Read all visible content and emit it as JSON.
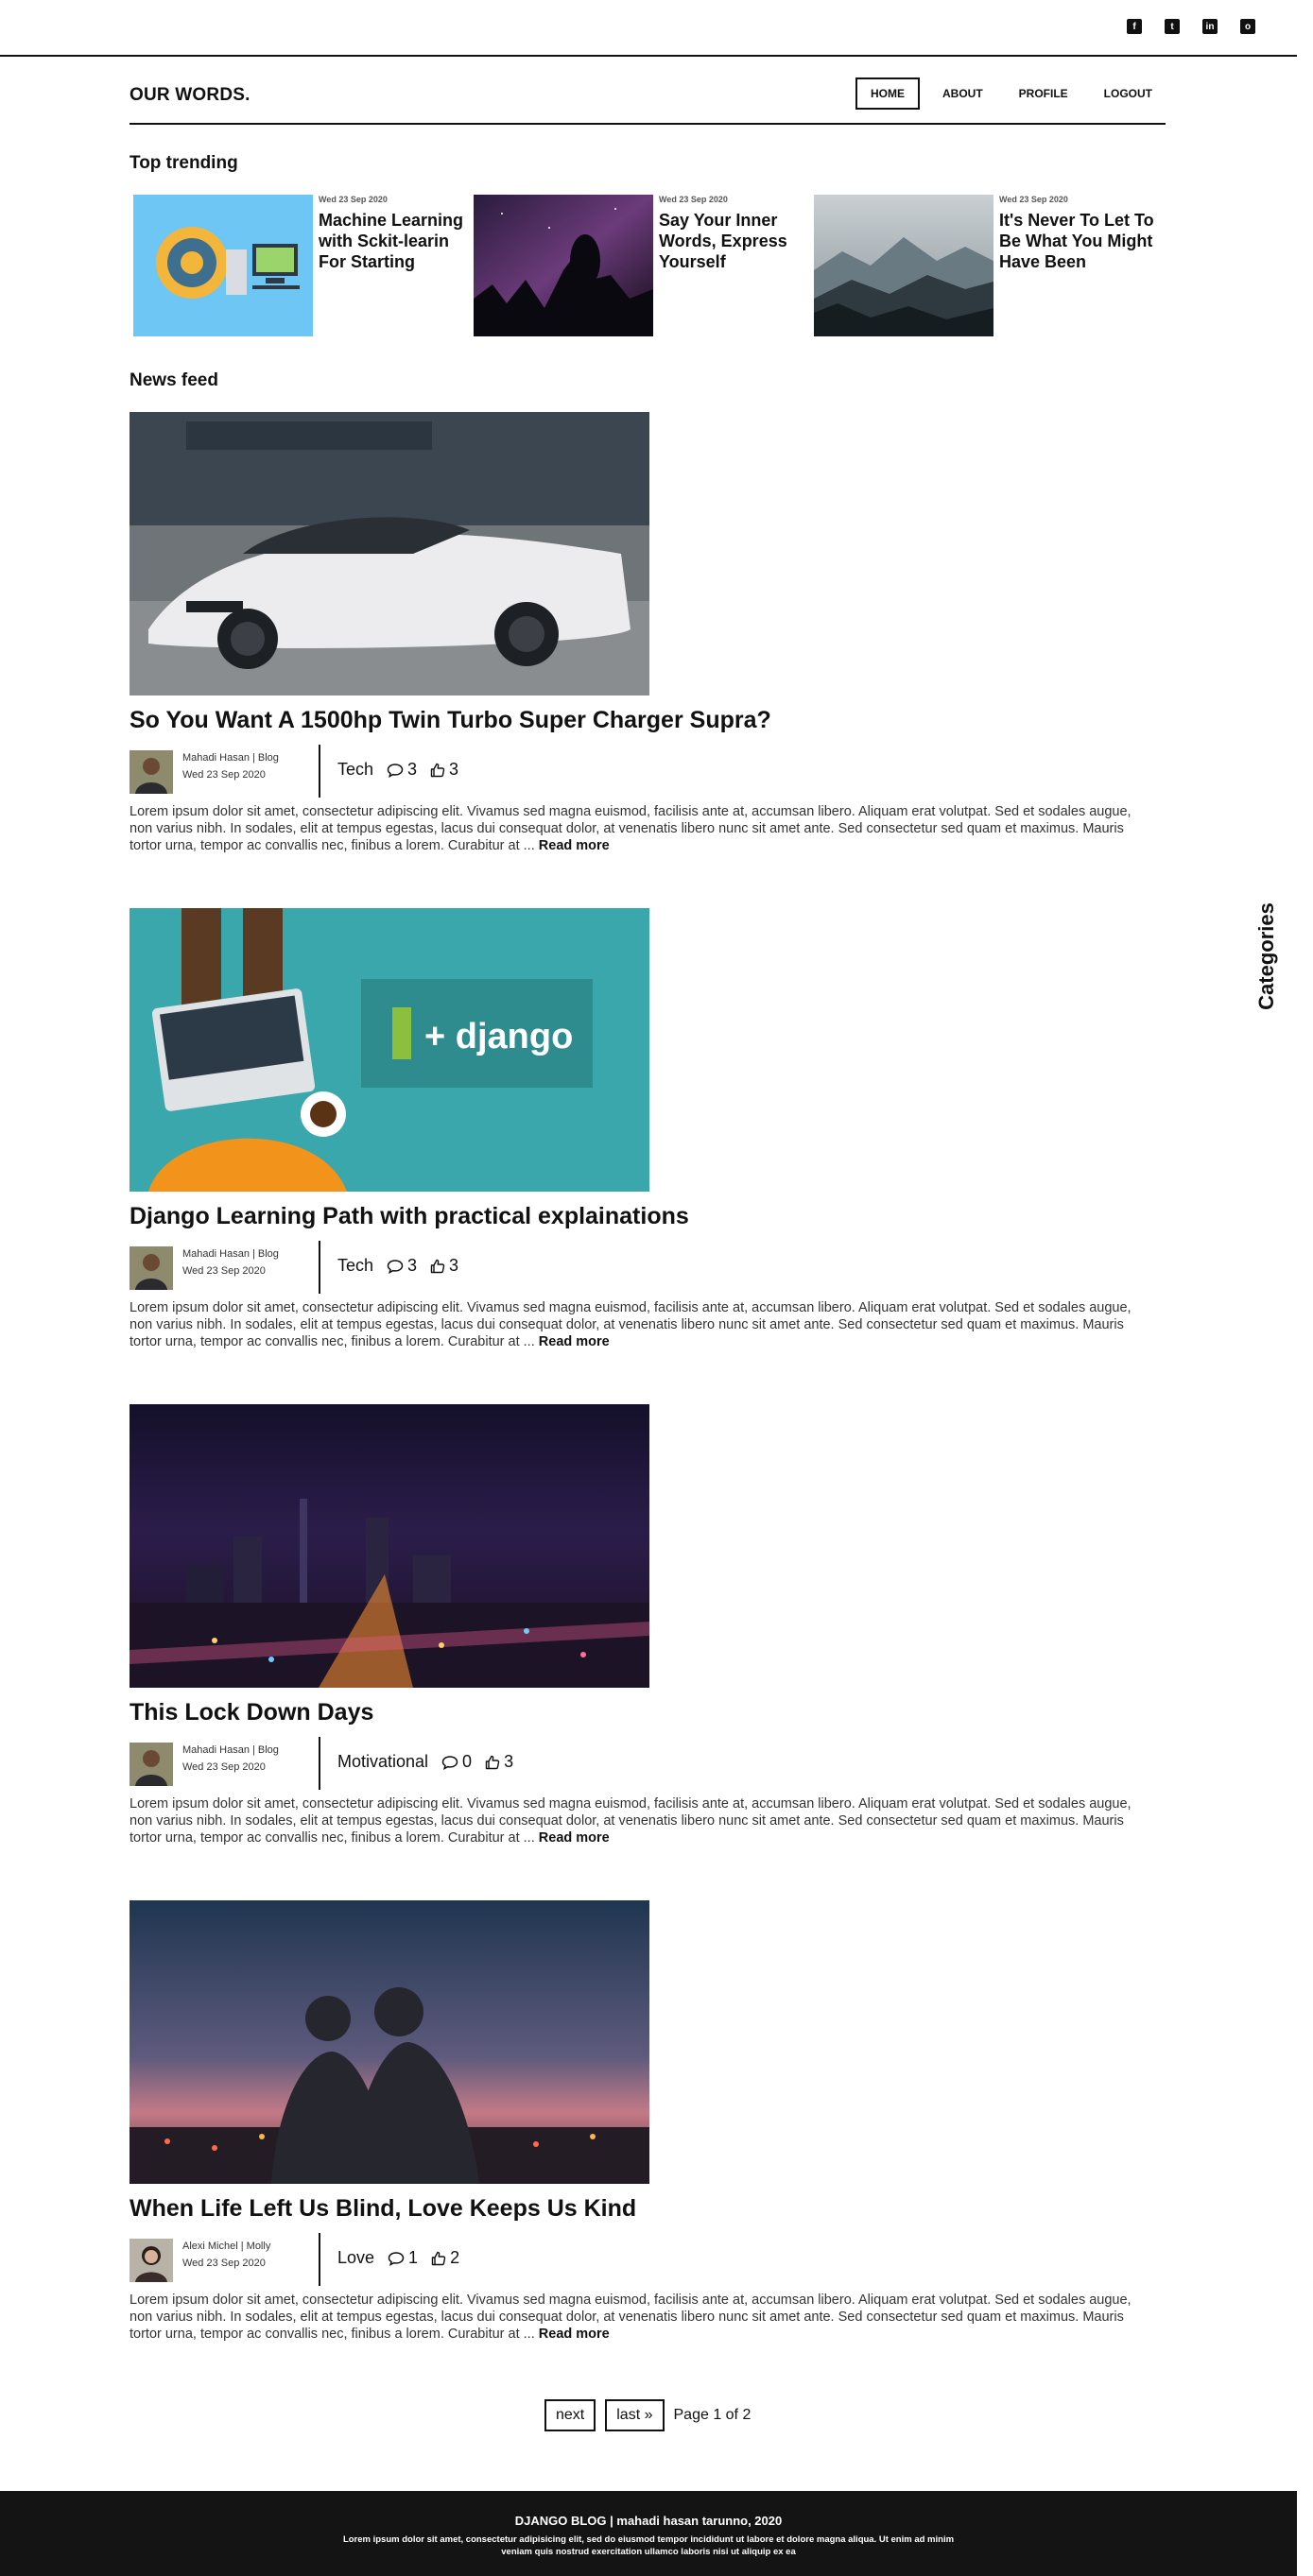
{
  "social": [
    {
      "name": "facebook",
      "icon": "facebook-icon",
      "glyph": "f"
    },
    {
      "name": "twitter",
      "icon": "twitter-icon",
      "glyph": "t"
    },
    {
      "name": "linkedin",
      "icon": "linkedin-icon",
      "glyph": "in"
    },
    {
      "name": "github",
      "icon": "github-icon",
      "glyph": "o"
    }
  ],
  "header": {
    "brand": "OUR WORDS.",
    "nav": [
      {
        "label": "HOME",
        "active": true
      },
      {
        "label": "ABOUT",
        "active": false
      },
      {
        "label": "PROFILE",
        "active": false
      },
      {
        "label": "LOGOUT",
        "active": false
      }
    ]
  },
  "trending": {
    "title": "Top trending",
    "items": [
      {
        "date": "Wed 23 Sep 2020",
        "title": "Machine Learning with Sckit-learin For Starting",
        "image": "ml-illustration"
      },
      {
        "date": "Wed 23 Sep 2020",
        "title": "Say Your Inner Words, Express Yourself",
        "image": "night-sky-photo"
      },
      {
        "date": "Wed 23 Sep 2020",
        "title": "It's Never To Let To Be What You Might Have Been",
        "image": "mountain-photo"
      }
    ]
  },
  "feed": {
    "title": "News feed",
    "posts": [
      {
        "title": "So You Want A 1500hp Twin Turbo Super Charger Supra?",
        "author": "Mahadi Hasan | Blog",
        "date": "Wed 23 Sep 2020",
        "category": "Tech",
        "comments": "3",
        "likes": "3",
        "image": "car-photo",
        "excerpt": "Lorem ipsum dolor sit amet, consectetur adipiscing elit. Vivamus sed magna euismod, facilisis ante at, accumsan libero. Aliquam erat volutpat. Sed et sodales augue, non varius nibh. In sodales, elit at tempus egestas, lacus dui consequat dolor, at venenatis libero nunc sit amet ante. Sed consectetur sed quam et maximus. Mauris tortor urna, tempor ac convallis nec, finibus a lorem. Curabitur at ...",
        "read_more": "Read more"
      },
      {
        "title": "Django Learning Path with practical explainations",
        "author": "Mahadi Hasan | Blog",
        "date": "Wed 23 Sep 2020",
        "category": "Tech",
        "comments": "3",
        "likes": "3",
        "image": "django-illustration",
        "image_text": "+ django",
        "excerpt": "Lorem ipsum dolor sit amet, consectetur adipiscing elit. Vivamus sed magna euismod, facilisis ante at, accumsan libero. Aliquam erat volutpat. Sed et sodales augue, non varius nibh. In sodales, elit at tempus egestas, lacus dui consequat dolor, at venenatis libero nunc sit amet ante. Sed consectetur sed quam et maximus. Mauris tortor urna, tempor ac convallis nec, finibus a lorem. Curabitur at ...",
        "read_more": "Read more"
      },
      {
        "title": "This Lock Down Days",
        "author": "Mahadi Hasan | Blog",
        "date": "Wed 23 Sep 2020",
        "category": "Motivational",
        "comments": "0",
        "likes": "3",
        "image": "city-night-photo",
        "excerpt": "Lorem ipsum dolor sit amet, consectetur adipiscing elit. Vivamus sed magna euismod, facilisis ante at, accumsan libero. Aliquam erat volutpat. Sed et sodales augue, non varius nibh. In sodales, elit at tempus egestas, lacus dui consequat dolor, at venenatis libero nunc sit amet ante. Sed consectetur sed quam et maximus. Mauris tortor urna, tempor ac convallis nec, finibus a lorem. Curabitur at ...",
        "read_more": "Read more"
      },
      {
        "title": "When Life Left Us Blind, Love Keeps Us Kind",
        "author": "Alexi Michel | Molly",
        "date": "Wed 23 Sep 2020",
        "category": "Love",
        "comments": "1",
        "likes": "2",
        "image": "couple-sunset-photo",
        "excerpt": "Lorem ipsum dolor sit amet, consectetur adipiscing elit. Vivamus sed magna euismod, facilisis ante at, accumsan libero. Aliquam erat volutpat. Sed et sodales augue, non varius nibh. In sodales, elit at tempus egestas, lacus dui consequat dolor, at venenatis libero nunc sit amet ante. Sed consectetur sed quam et maximus. Mauris tortor urna, tempor ac convallis nec, finibus a lorem. Curabitur at ...",
        "read_more": "Read more"
      }
    ]
  },
  "sidebar": {
    "tab_label": "Categories"
  },
  "pagination": {
    "next": "next",
    "last": "last »",
    "page_info": "Page 1 of 2"
  },
  "footer": {
    "title": "DJANGO BLOG | mahadi hasan tarunno, 2020",
    "text": "Lorem ipsum dolor sit amet, consectetur adipisicing elit, sed do eiusmod tempor incididunt ut labore et dolore magna aliqua. Ut enim ad minim veniam quis nostrud exercitation ullamco laboris nisi ut aliquip ex ea"
  },
  "colors": {
    "accent": "#111111",
    "footer_bg": "#141414",
    "django_bg": "#3aa7ad"
  }
}
